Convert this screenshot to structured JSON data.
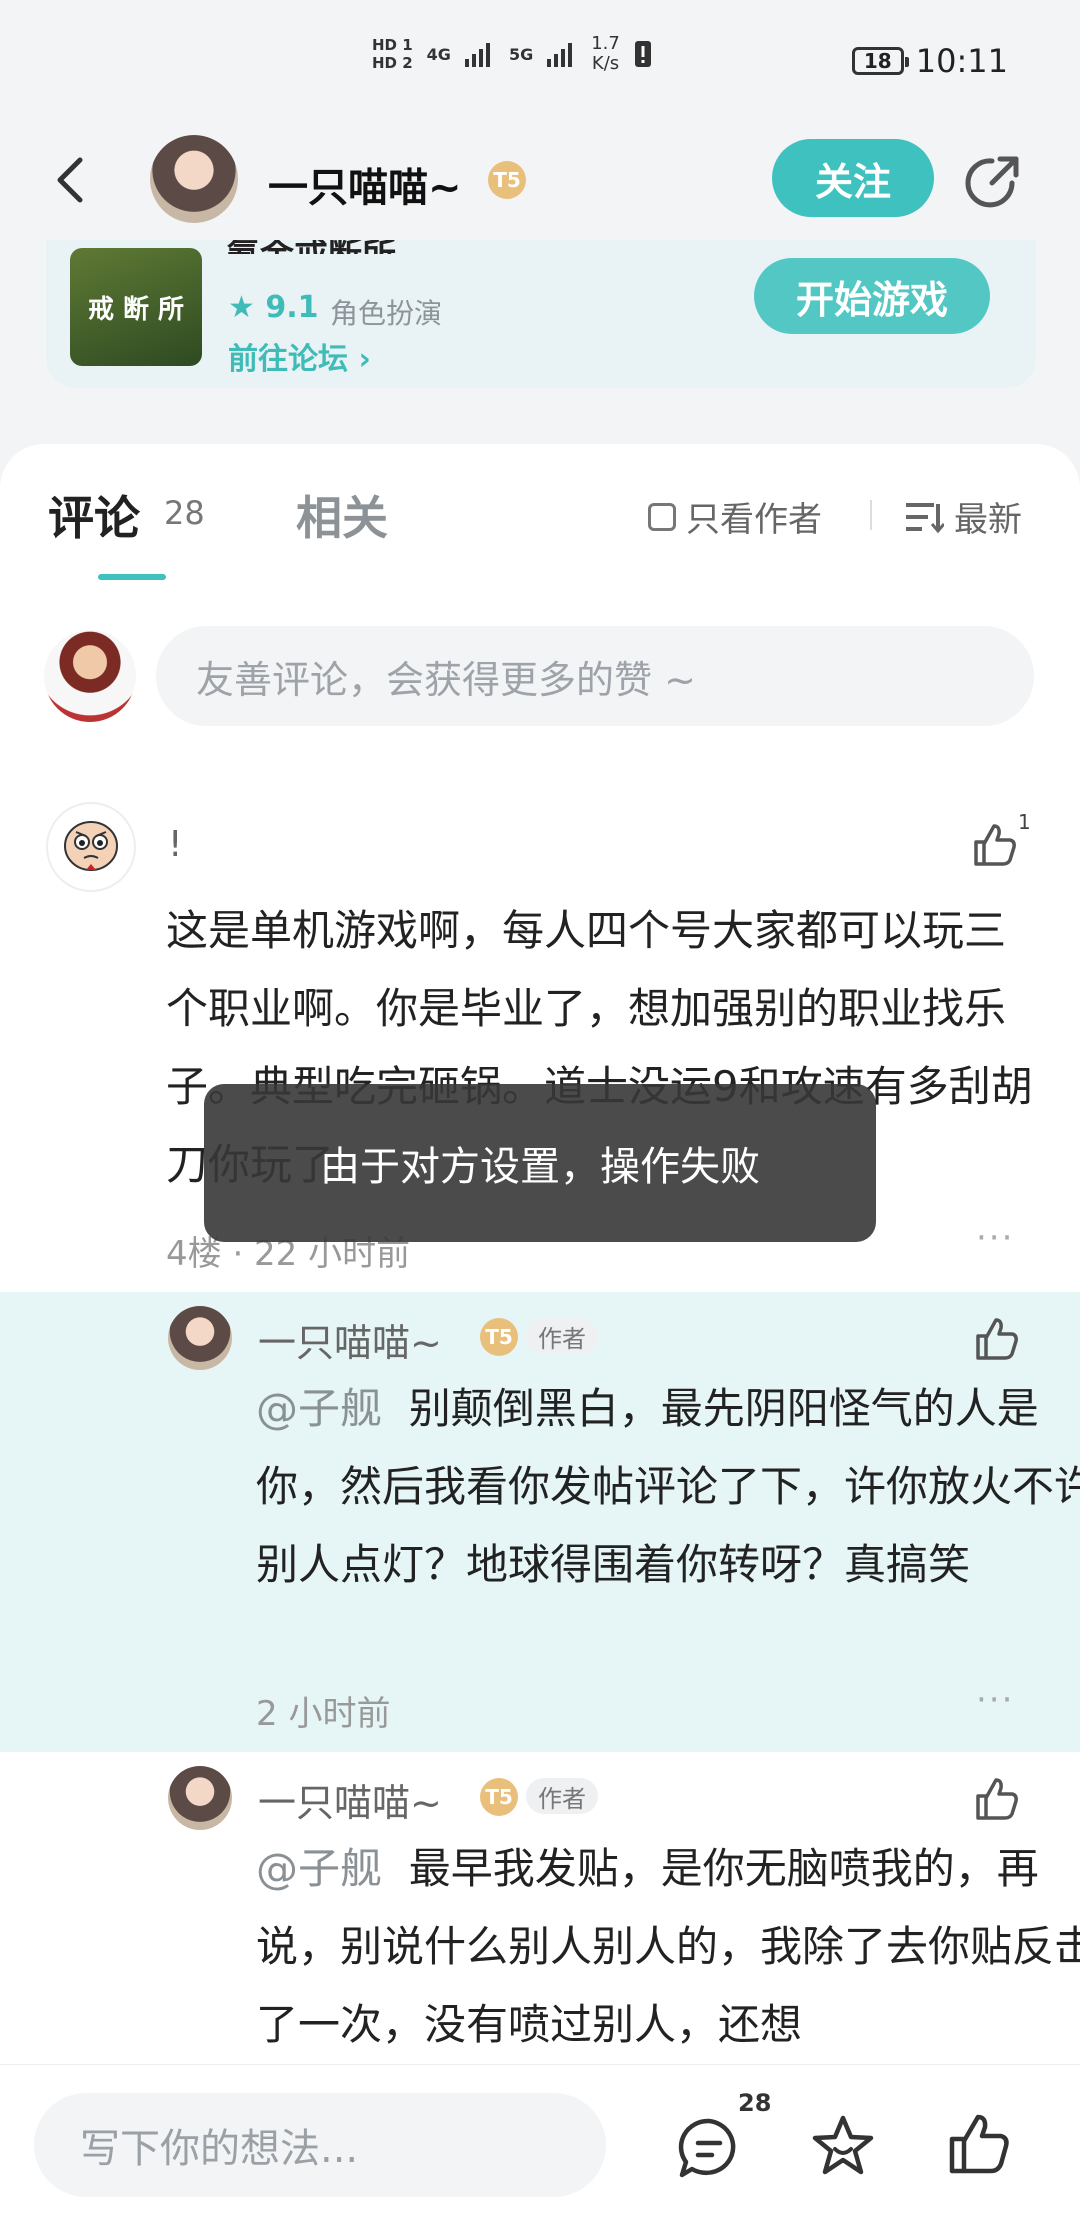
{
  "status_bar": {
    "hd1": "HD 1",
    "hd2": "HD 2",
    "net1": "4G",
    "net2": "5G",
    "speed_value": "1.7",
    "speed_unit": "K/s",
    "battery": "18",
    "time": "10:11"
  },
  "header": {
    "author_name": "一只喵喵~",
    "level_badge": "T5",
    "follow_label": "关注"
  },
  "game": {
    "title": "氪金戒断所",
    "icon_text": "戒 断 所",
    "rating": "★ 9.1",
    "genre": "角色扮演",
    "forum_link": "前往论坛 ›",
    "start_label": "开始游戏"
  },
  "tabs": {
    "comments_label": "评论",
    "comments_count": "28",
    "related_label": "相关",
    "only_author": "只看作者",
    "sort_label": "最新"
  },
  "composer": {
    "placeholder": "友善评论，会获得更多的赞 ~"
  },
  "main_comment": {
    "user": "!",
    "likes": "1",
    "body": "这是单机游戏啊，每人四个号大家都可以玩三个职业啊。你是毕业了，想加强别的职业找乐子。典型吃完砸锅。道士没运9和攻速有多刮胡刀你玩了",
    "meta": "4楼 · 22 小时前",
    "more": "···"
  },
  "replies": [
    {
      "name": "一只喵喵~",
      "level": "T5",
      "tag": "作者",
      "mention": "@子舰",
      "text": "别颠倒黑白，最先阴阳怪气的人是你，然后我看你发帖评论了下，许你放火不许别人点灯？地球得围着你转呀？真搞笑",
      "meta": "2 小时前",
      "more": "···"
    },
    {
      "name": "一只喵喵~",
      "level": "T5",
      "tag": "作者",
      "mention": "@子舰",
      "text": "最早我发贴，是你无脑喷我的，再说，别说什么别人别人的，我除了去你贴反击了一次，没有喷过别人，还想"
    }
  ],
  "toast": {
    "message": "由于对方设置，操作失败"
  },
  "bottom_bar": {
    "placeholder": "写下你的想法...",
    "comment_count": "28"
  },
  "colors": {
    "accent": "#3fc2bf",
    "reply_highlight": "#e6f6f6"
  }
}
